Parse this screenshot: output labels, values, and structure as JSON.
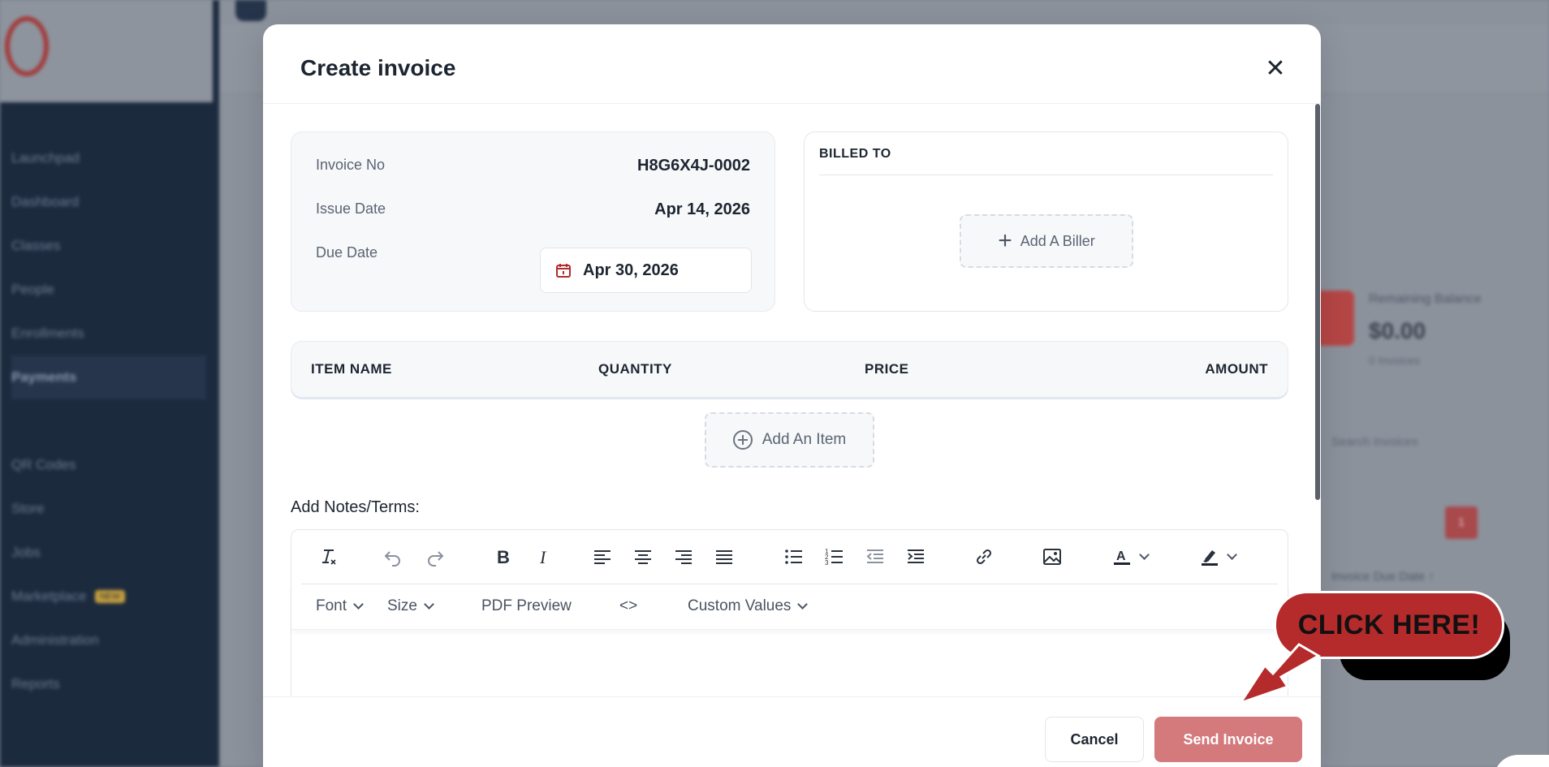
{
  "background": {
    "sidebar_items": [
      {
        "label": "Launchpad"
      },
      {
        "label": "Dashboard"
      },
      {
        "label": "Classes"
      },
      {
        "label": "People"
      },
      {
        "label": "Enrollments"
      },
      {
        "label": "Payments"
      },
      {
        "label": ""
      },
      {
        "label": "QR Codes"
      },
      {
        "label": "Store"
      },
      {
        "label": "Jobs"
      },
      {
        "label": "Marketplace",
        "badge": "NEW"
      },
      {
        "label": "Administration"
      },
      {
        "label": "Reports"
      }
    ],
    "card_title": "Remaining Balance",
    "card_value": "$0.00",
    "card_sub": "0 Invoices",
    "search_placeholder": "Search Invoices",
    "current_page": "1",
    "sort_label": "Invoice Due Date ↑"
  },
  "modal": {
    "title": "Create invoice",
    "invoice": {
      "invoice_no_label": "Invoice No",
      "invoice_no": "H8G6X4J-0002",
      "issue_date_label": "Issue Date",
      "issue_date": "Apr 14, 2026",
      "due_date_label": "Due Date",
      "due_date": "Apr 30, 2026"
    },
    "billed_to": {
      "heading": "BILLED TO",
      "add_biller_label": "Add A Biller"
    },
    "items_table": {
      "columns": [
        "ITEM NAME",
        "QUANTITY",
        "PRICE",
        "AMOUNT"
      ],
      "add_item_label": "Add An Item"
    },
    "notes": {
      "label": "Add Notes/Terms:",
      "toolbar": {
        "font_label": "Font",
        "size_label": "Size",
        "pdf_preview_label": "PDF Preview",
        "code_label": "<>",
        "custom_values_label": "Custom Values"
      }
    },
    "footer": {
      "cancel_label": "Cancel",
      "send_label": "Send Invoice"
    }
  },
  "callout": {
    "text": "CLICK HERE!"
  },
  "colors": {
    "accent": "#b52a2a",
    "send_button": "#d4797c",
    "sidebar": "#1c2a3e"
  }
}
